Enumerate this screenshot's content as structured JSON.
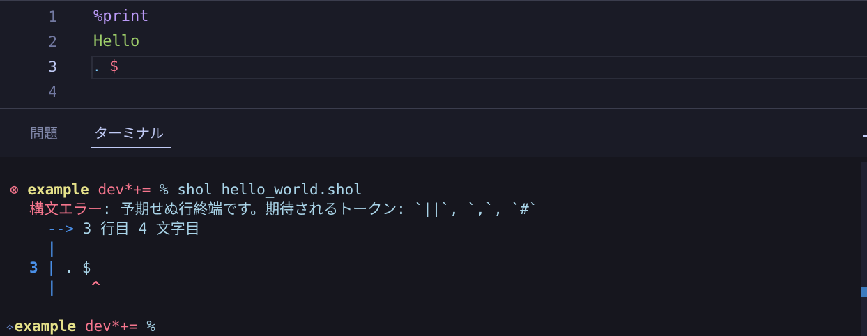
{
  "editor": {
    "lines": [
      {
        "number": "1",
        "segments": [
          {
            "text": "%print",
            "kind": "directive"
          }
        ]
      },
      {
        "number": "2",
        "segments": [
          {
            "text": "Hello",
            "kind": "text"
          }
        ]
      },
      {
        "number": "3",
        "segments": [
          {
            "text": ".",
            "kind": "dot"
          },
          {
            "text": " ",
            "kind": "space"
          },
          {
            "text": "$",
            "kind": "dollar"
          }
        ]
      },
      {
        "number": "4",
        "segments": []
      }
    ],
    "active_line": "3"
  },
  "panel": {
    "tabs": [
      {
        "label": "問題",
        "active": false
      },
      {
        "label": "ターミナル",
        "active": true
      }
    ]
  },
  "terminal": {
    "error_icon": "⊗",
    "prompt_dir": "example",
    "prompt_branch": "dev*+=",
    "prompt_symbol": "%",
    "command": "shol hello_world.shol",
    "error_label": "構文エラー",
    "error_message": ": 予期せぬ行終端です。期待されるトークン: `||`, `,`, `#`",
    "location_arrow": "-->",
    "location_text": "3 行目 4 文字目",
    "gutter_bar": "|",
    "gutter_line_number": "3",
    "source_line": ". $",
    "caret": "^",
    "spark_icon": "✧",
    "colors": {
      "error": "#f7768e",
      "prompt_dir": "#e6e28a",
      "gutter": "#4a8fe7",
      "message": "#a9d4e8"
    }
  }
}
